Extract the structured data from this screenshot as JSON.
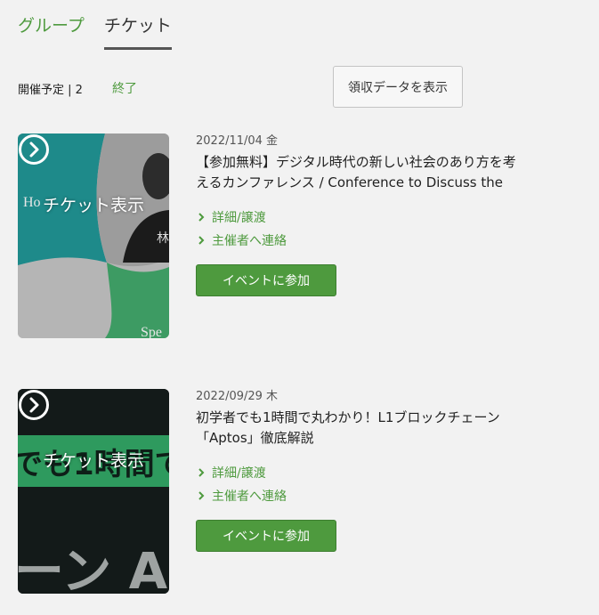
{
  "tabs": {
    "group": "グループ",
    "ticket": "チケット"
  },
  "filters": {
    "upcoming": "開催予定 | 2",
    "ended": "終了",
    "receipt_button": "領収データを表示"
  },
  "events": [
    {
      "date": "2022/11/04 金",
      "title": "【参加無料】デジタル時代の新しい社会のあり方を考えるカンファレンス / Conference to Discuss the New Way of Society in the Digital Age",
      "thumb_label": "チケット表示",
      "thumb_fragments": [
        "Ho",
        "林",
        "Spe"
      ],
      "details_link": "詳細/譲渡",
      "contact_link": "主催者へ連絡",
      "join_button": "イベントに参加"
    },
    {
      "date": "2022/09/29 木",
      "title": "初学者でも1時間で丸わかり！L1ブロックチェーン「Aptos」徹底解説",
      "thumb_label": "チケット表示",
      "thumb_fragments": [
        "でも1時間で丸わ",
        "ーン Ap"
      ],
      "details_link": "詳細/譲渡",
      "contact_link": "主催者へ連絡",
      "join_button": "イベントに参加"
    }
  ],
  "colors": {
    "accent": "#4e9a3e",
    "background": "#f2f2f2"
  }
}
